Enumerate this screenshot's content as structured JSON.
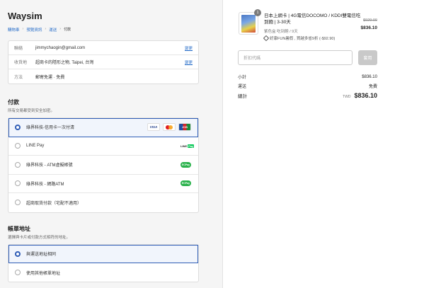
{
  "brand": "Waysim",
  "breadcrumb": [
    "購物車",
    "預覽資訊",
    "運送",
    "付款"
  ],
  "info": [
    {
      "label": "聯絡",
      "value": "jimmychaogin@gmail.com",
      "action": "變更"
    },
    {
      "label": "收貨地",
      "value": "超商卡的隱形之物, Taipei, 台灣",
      "action": "變更"
    },
    {
      "label": "方法",
      "value": "郵寄免運 · 免費",
      "action": ""
    }
  ],
  "payment": {
    "title": "付款",
    "subtitle": "所有交易都受到安全加密。",
    "options": [
      {
        "label": "綠界科技-信用卡一次付清",
        "selected": true,
        "icons": [
          "visa-icon",
          "mastercard-icon",
          "jcb-icon"
        ],
        "icon_text": {
          "visa": "VISA",
          "jcb": "JCB"
        }
      },
      {
        "label": "LINE Pay",
        "selected": false,
        "icons": [
          "linepay-icon"
        ],
        "icon_text": {
          "line": "LINE",
          "pay": "Pay"
        }
      },
      {
        "label": "綠界科技 - ATM虛擬帳號",
        "selected": false,
        "icons": [
          "ecpay-icon"
        ],
        "icon_text": {
          "ecpay": "ECPay"
        }
      },
      {
        "label": "綠界科技 - 網路ATM",
        "selected": false,
        "icons": [
          "ecpay-icon"
        ],
        "icon_text": {
          "ecpay": "ECPay"
        }
      },
      {
        "label": "超商取貨付款（宅配不適用）",
        "selected": false,
        "icons": [],
        "icon_text": {}
      }
    ]
  },
  "billing": {
    "title": "帳單地址",
    "subtitle": "選擇與卡片或付款方式相符的地址。",
    "options": [
      {
        "label": "與運送地址相同",
        "selected": true
      },
      {
        "label": "使用其他帳單地址",
        "selected": false
      }
    ]
  },
  "cart": {
    "quantity": "1",
    "product_name": "日本上網卡 | 4G電信DOCOMO / KDDI雙電信吃到飽 | 3-30天",
    "variant": "吃到飽 / 9天",
    "variant_prefix": "紫色盒",
    "discount": "好康FUN暑假 , 買越多省9折 (-$92.90)",
    "old_price": "$929.00",
    "price": "$836.10"
  },
  "coupon": {
    "placeholder": "折扣代碼",
    "button": "套用"
  },
  "summary": {
    "subtotal_label": "小計",
    "subtotal": "$836.10",
    "shipping_label": "運送",
    "shipping": "免費",
    "total_label": "總計",
    "currency": "TWD",
    "total": "$836.10"
  }
}
